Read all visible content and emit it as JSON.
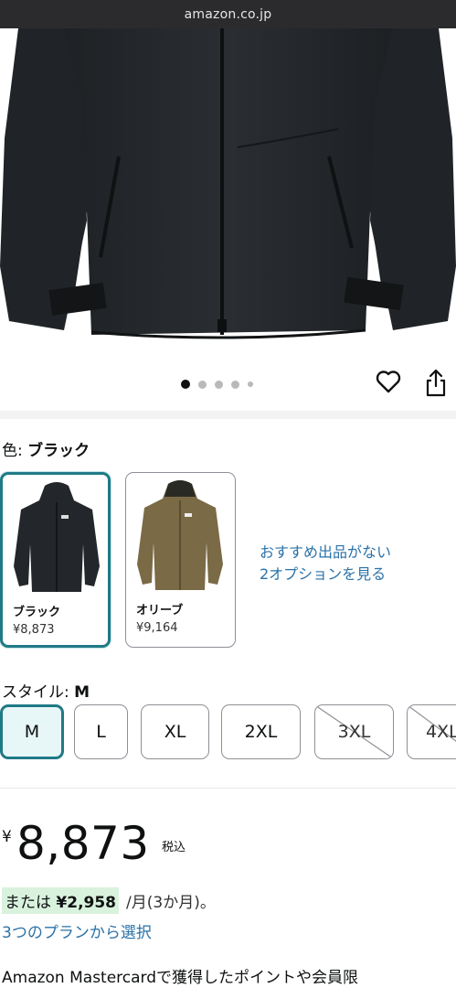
{
  "browser": {
    "url": "amazon.co.jp"
  },
  "gallery": {
    "image_icon": "black-hooded-jacket-photo",
    "dots_total": 5,
    "dots_active_index": 0,
    "wishlist_icon": "heart-icon",
    "share_icon": "share-icon"
  },
  "color": {
    "label": "色: ",
    "selected": "ブラック",
    "options": [
      {
        "name": "ブラック",
        "price": "¥8,873",
        "swatch_color": "#23272b",
        "selected": true
      },
      {
        "name": "オリーブ",
        "price": "¥9,164",
        "swatch_color": "#7a6a45",
        "selected": false
      }
    ],
    "more_options_link": [
      "おすすめ出品がない",
      "2オプションを見る"
    ]
  },
  "style": {
    "label": "スタイル: ",
    "selected": "M",
    "sizes": [
      {
        "label": "M",
        "selected": true,
        "available": true
      },
      {
        "label": "L",
        "selected": false,
        "available": true
      },
      {
        "label": "XL",
        "selected": false,
        "available": true
      },
      {
        "label": "2XL",
        "selected": false,
        "available": true
      },
      {
        "label": "3XL",
        "selected": false,
        "available": false
      },
      {
        "label": "4XL",
        "selected": false,
        "available": false
      }
    ]
  },
  "price": {
    "currency": "¥",
    "amount": "8,873",
    "tax_note": "税込"
  },
  "installment": {
    "prefix": "または",
    "amount": "¥2,958",
    "suffix": "/月(3か月)。",
    "link": "3つのプランから選択"
  },
  "promo_text": "Amazon Mastercardで獲得したポイントや会員限",
  "colors": {
    "accent": "#1f7a86",
    "link": "#2a72a8",
    "highlight": "#d9f2de"
  }
}
